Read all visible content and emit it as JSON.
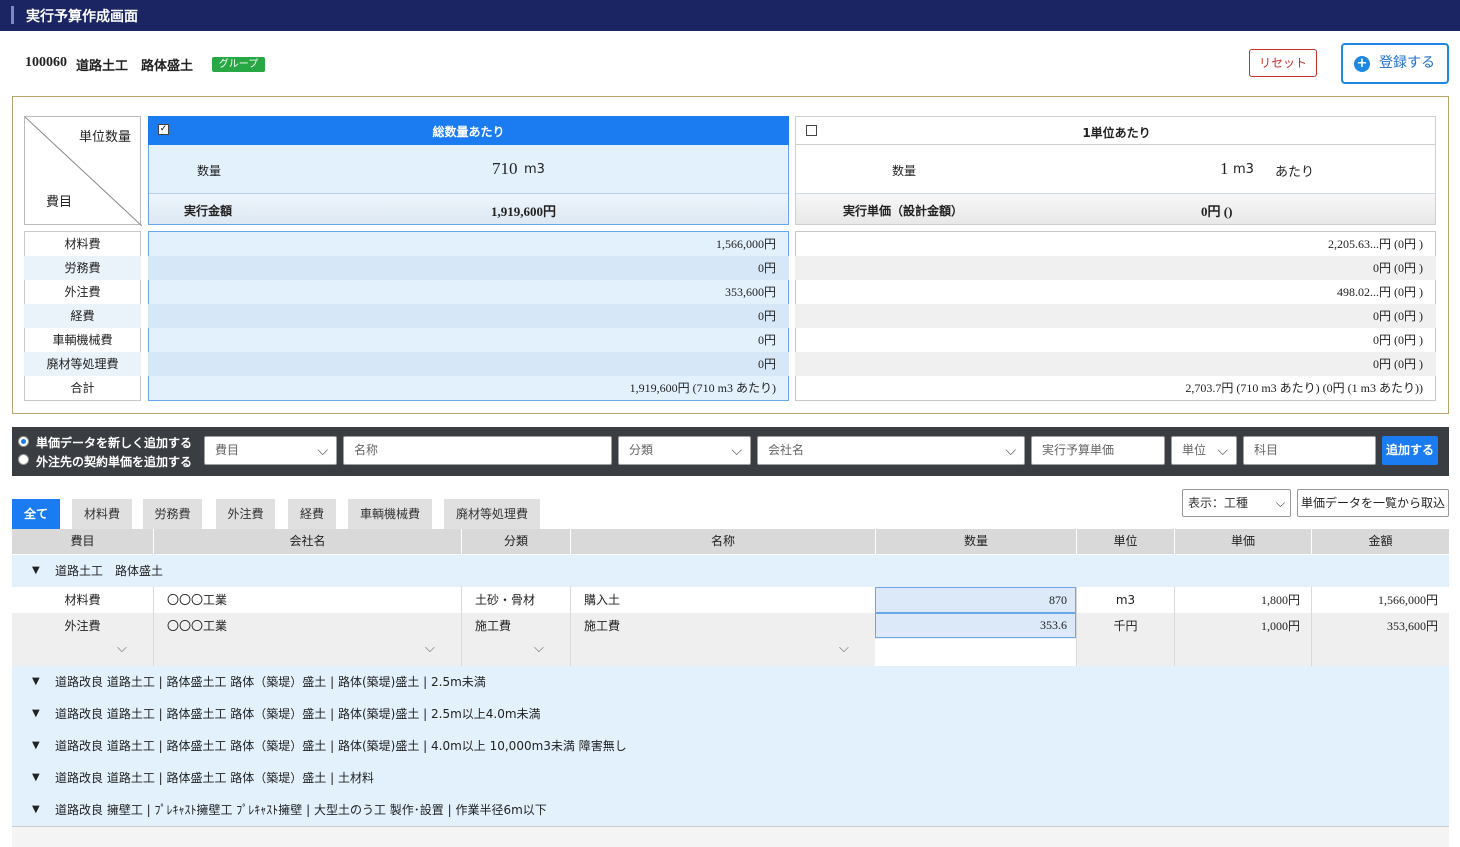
{
  "window": {
    "title": "実行予算作成画面"
  },
  "header": {
    "code": "100060",
    "name": "道路土工　路体盛土",
    "badge": "グループ",
    "reset_label": "リセット",
    "register_label": "登録する"
  },
  "summary": {
    "diagonal_top": "単位数量",
    "diagonal_bottom": "費目",
    "total": {
      "header": "総数量あたり",
      "checked": true,
      "qty_label": "数量",
      "qty_value": "710",
      "qty_unit": "m3",
      "amount_label": "実行金額",
      "amount_value": "1,919,600円"
    },
    "unit": {
      "header": "1単位あたり",
      "checked": false,
      "qty_label": "数量",
      "qty_value": "1",
      "qty_unit": "m3",
      "qty_suffix": "あたり",
      "amount_label": "実行単価（設計金額）",
      "amount_value": "0円 ()"
    },
    "rows": [
      {
        "label": "材料費",
        "total": "1,566,000円",
        "unit": "2,205.63...円 (0円 )"
      },
      {
        "label": "労務費",
        "total": "0円",
        "unit": "0円 (0円 )"
      },
      {
        "label": "外注費",
        "total": "353,600円",
        "unit": "498.02...円 (0円 )"
      },
      {
        "label": "経費",
        "total": "0円",
        "unit": "0円 (0円 )"
      },
      {
        "label": "車輌機械費",
        "total": "0円",
        "unit": "0円 (0円 )"
      },
      {
        "label": "廃材等処理費",
        "total": "0円",
        "unit": "0円 (0円 )"
      },
      {
        "label": "合計",
        "total": "1,919,600円 (710 m3 あたり)",
        "unit": "2,703.7円 (710 m3 あたり) (0円 (1 m3 あたり))"
      }
    ]
  },
  "add_bar": {
    "radio_new": "単価データを新しく追加する",
    "radio_contract": "外注先の契約単価を追加する",
    "radio_selected": "new",
    "f_himoku": "費目",
    "f_name": "名称",
    "f_bunrui": "分類",
    "f_company": "会社名",
    "f_price": "実行予算単価",
    "f_unit": "単位",
    "f_kamoku": "科目",
    "add_label": "追加する"
  },
  "tabs": [
    "全て",
    "材料費",
    "労務費",
    "外注費",
    "経費",
    "車輌機械費",
    "廃材等処理費"
  ],
  "active_tab": "全て",
  "display_select": "表示：工種",
  "import_label": "単価データを一覧から取込",
  "grid": {
    "columns": [
      "費目",
      "会社名",
      "分類",
      "名称",
      "数量",
      "単位",
      "単価",
      "金額"
    ],
    "first_group": "道路土工　路体盛土",
    "rows": [
      {
        "himoku": "材料費",
        "company": "〇〇〇工業",
        "bunrui": "土砂・骨材",
        "name": "購入土",
        "qty": "870",
        "unit": "m3",
        "price": "1,800円",
        "amount": "1,566,000円"
      },
      {
        "himoku": "外注費",
        "company": "〇〇〇工業",
        "bunrui": "施工費",
        "name": "施工費",
        "qty": "353.6",
        "unit": "千円",
        "price": "1,000円",
        "amount": "353,600円"
      }
    ],
    "other_groups": [
      "道路改良 道路土工 | 路体盛土工 路体（築堤）盛土 | 路体(築堤)盛土 | 2.5m未満",
      "道路改良 道路土工 | 路体盛土工 路体（築堤）盛土 | 路体(築堤)盛土 | 2.5m以上4.0m未満",
      "道路改良 道路土工 | 路体盛土工 路体（築堤）盛土 | 路体(築堤)盛土 | 4.0m以上 10,000m3未満 障害無し",
      "道路改良 道路土工 | 路体盛土工 路体（築堤）盛土 | 土材料",
      "道路改良 擁壁工 | ﾌﾟﾚｷｬｽﾄ擁壁工 ﾌﾟﾚｷｬｽﾄ擁壁 | 大型土のう工 製作･設置 | 作業半径6m以下"
    ]
  },
  "colors": {
    "titlebar": "#1b2563",
    "accent": "#1a7cf0",
    "badge": "#28a745",
    "reset": "#c9302c",
    "row_tint": "#e3f1fd"
  }
}
